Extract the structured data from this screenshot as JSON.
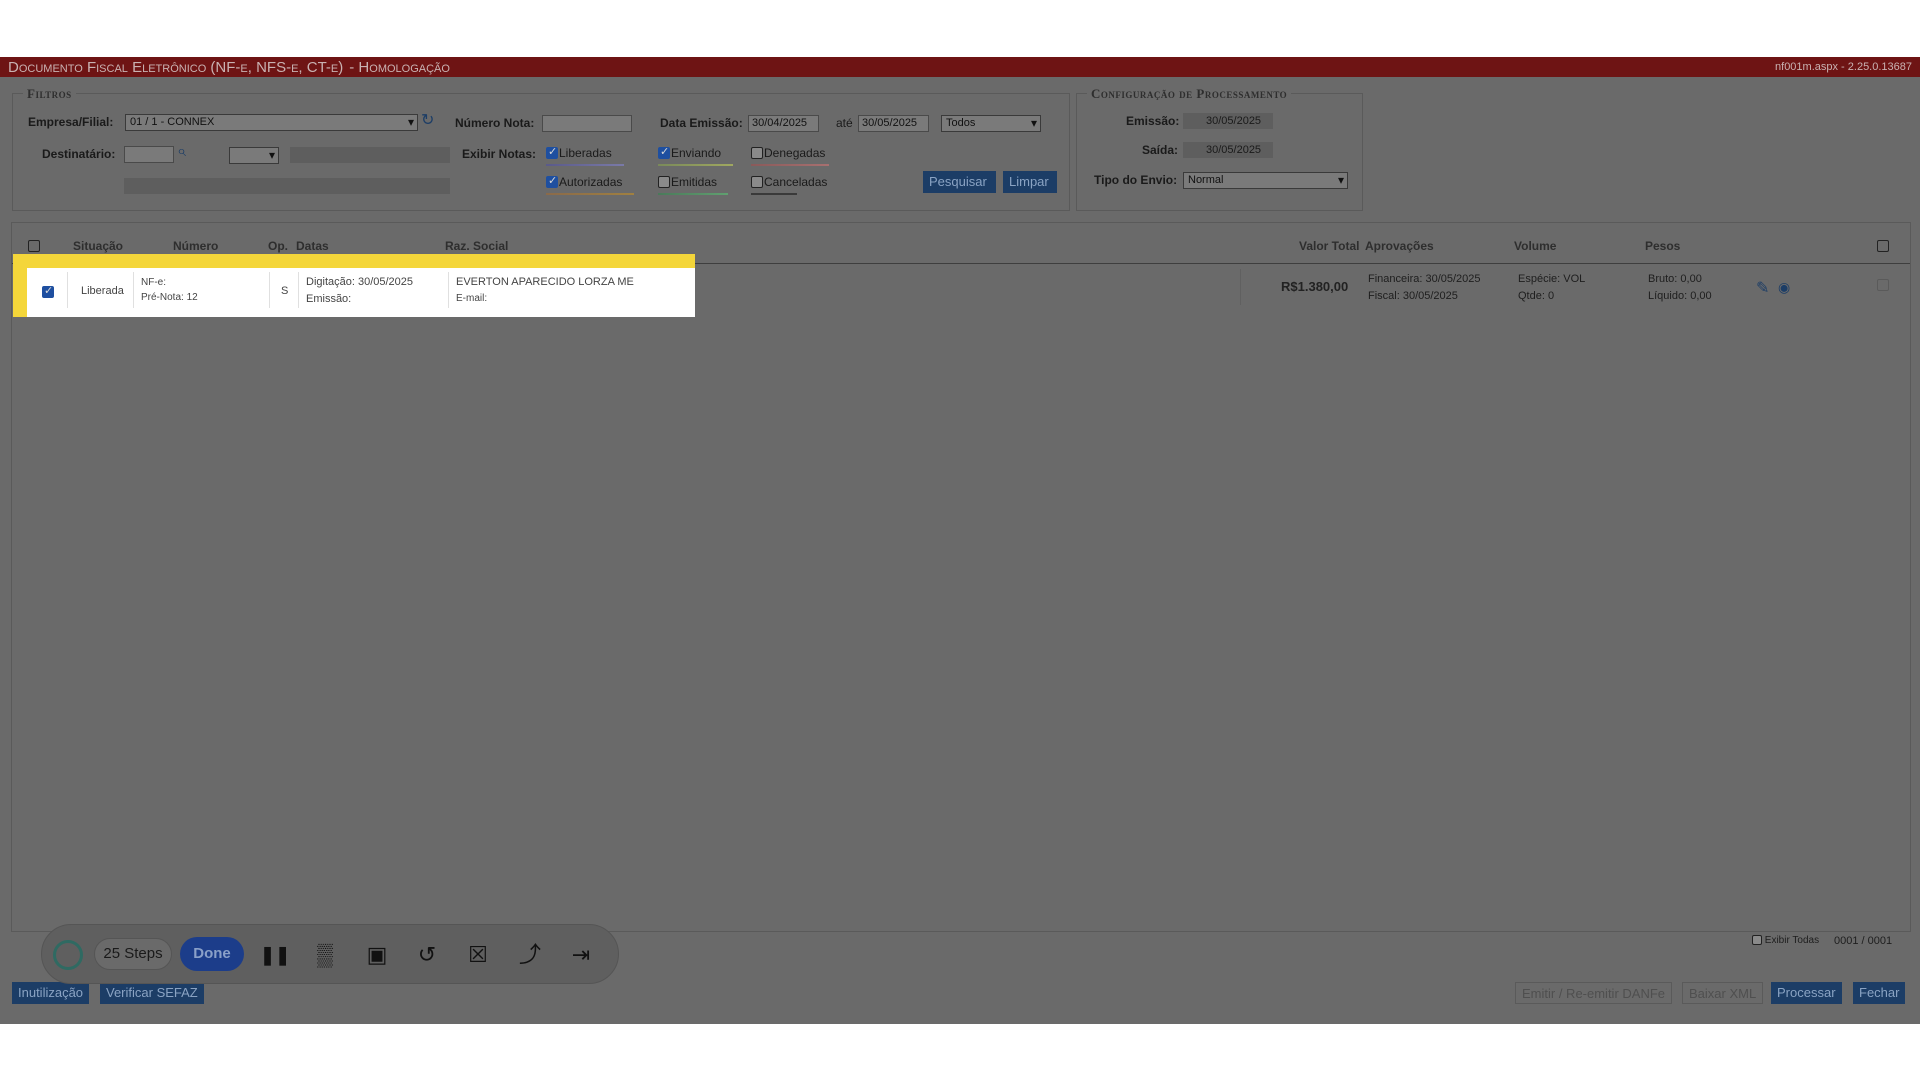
{
  "window": {
    "title": "Documento Fiscal Eletrônico (NF-e, NFS-e, CT-e)",
    "env": " - Homologação",
    "version": "nf001m.aspx - 2.25.0.13687"
  },
  "filters": {
    "legend": "Filtros",
    "empresa_label": "Empresa/Filial:",
    "empresa_value": "01 / 1 - CONNEX",
    "destinatario_label": "Destinatário:",
    "numero_nota_label": "Número Nota:",
    "numero_nota_value": "",
    "data_emissao_label": "Data Emissão:",
    "data_de": "30/04/2025",
    "ate_label": "até",
    "data_ate": "30/05/2025",
    "periodo_value": "Todos",
    "exibir_label": "Exibir Notas:",
    "checkboxes": {
      "liberadas": "Liberadas",
      "enviando": "Enviando",
      "denegadas": "Denegadas",
      "autorizadas": "Autorizadas",
      "emitidas": "Emitidas",
      "canceladas": "Canceladas"
    },
    "pesquisar": "Pesquisar",
    "limpar": "Limpar"
  },
  "config": {
    "legend": "Configuração de Processamento",
    "emissao_label": "Emissão:",
    "emissao_value": "30/05/2025",
    "saida_label": "Saída:",
    "saida_value": "30/05/2025",
    "tipo_label": "Tipo do Envio:",
    "tipo_value": "Normal"
  },
  "grid": {
    "headers": {
      "situacao": "Situação",
      "numero": "Número",
      "op": "Op.",
      "datas": "Datas",
      "raz_social": "Raz. Social",
      "valor_total": "Valor Total",
      "aprovacoes": "Aprovações",
      "volume": "Volume",
      "pesos": "Pesos"
    },
    "row": {
      "situacao": "Liberada",
      "nfe": "NF-e:",
      "pre_nota": "Pré-Nota:  12",
      "op": "S",
      "digitacao": "Digitação:  30/05/2025",
      "emissao": "Emissão:",
      "raz_social": "EVERTON APARECIDO LORZA ME",
      "email": "E-mail:",
      "valor": "R$1.380,00",
      "financeira": "Financeira:  30/05/2025",
      "fiscal": "Fiscal:  30/05/2025",
      "especie": "Espécie:  VOL",
      "qtde": "Qtde:  0",
      "bruto": "Bruto:  0,00",
      "liquido": "Líquido:  0,00"
    },
    "exibir_todas": "Exibir Todas",
    "paging": "0001 / 0001"
  },
  "footer": {
    "inutilizacao": "Inutilização",
    "verificar": "Verificar SEFAZ",
    "emitir": "Emitir / Re-emitir DANFe",
    "baixar": "Baixar XML",
    "processar": "Processar",
    "fechar": "Fechar"
  },
  "agent_toolbar": {
    "steps": "25 Steps",
    "done": "Done"
  },
  "colors": {
    "titlebar": "#6e1414",
    "button": "#1c3d66",
    "highlight": "#f4d63a"
  }
}
